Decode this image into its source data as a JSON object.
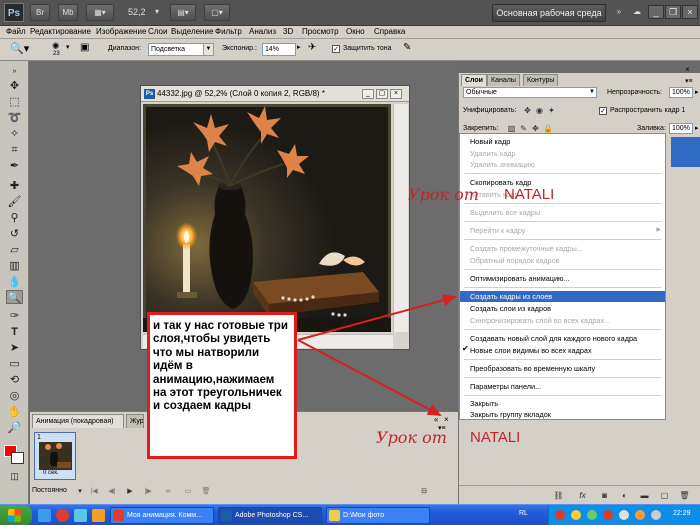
{
  "titlebar": {
    "app_logo": "Ps",
    "zoom": "52,2",
    "workspace": "Основная рабочая среда",
    "icons": [
      "bridge-icon",
      "minibridge-icon",
      "view-extras-icon",
      "zoom-dropdown-icon",
      "arrange-documents-icon",
      "screen-mode-icon"
    ]
  },
  "menu": [
    "Файл",
    "Редактирование",
    "Изображение",
    "Слои",
    "Выделение",
    "Фильтр",
    "Анализ",
    "3D",
    "Просмотр",
    "Окно",
    "Справка"
  ],
  "options": {
    "brush_size": "23",
    "range_label": "Диапазон:",
    "range_value": "Подсветка",
    "exposure_label": "Экспонир.:",
    "exposure_value": "14%",
    "protect_label": "Защитить тона"
  },
  "document": {
    "title": "44332.jpg @ 52,2% (Слой 0 копия 2, RGB/8) *"
  },
  "callout": {
    "text": "и так у нас  готовые три слоя,чтобы увидеть что мы натворили идём в анимацию,нажимаем на этот треугольничек и создаем кадры"
  },
  "watermarks": [
    {
      "script": "Урок  от",
      "name": "NATALI"
    },
    {
      "script": "Урок  от",
      "name": "NATALI"
    }
  ],
  "animation": {
    "tab_active": "Анимация (покадровая)",
    "tab_other": "Жур",
    "frame_number": "1",
    "frame_delay": "0 сек.",
    "loop": "Постоянно"
  },
  "layers_panel": {
    "tabs": [
      "Слои",
      "Каналы",
      "Контуры"
    ],
    "blend_mode": "Обычные",
    "opacity_label": "Непрозрачность:",
    "opacity_value": "100%",
    "unify_label": "Унифицировать:",
    "propagate_label": "Распространить кадр 1",
    "lock_label": "Закрепить:",
    "fill_label": "Заливка:",
    "fill_value": "100%"
  },
  "context_menu": {
    "items": [
      {
        "label": "Новый кадр",
        "state": "enabled"
      },
      {
        "label": "Удалить кадр",
        "state": "disabled"
      },
      {
        "label": "Удалить анимацию",
        "state": "disabled"
      },
      {
        "label": "Скопировать кадр",
        "state": "enabled"
      },
      {
        "label": "Вставить кадр...",
        "state": "disabled"
      },
      {
        "label": "Выделить все кадры",
        "state": "disabled"
      },
      {
        "label": "Перейти к кадру",
        "state": "disabled"
      },
      {
        "label": "Создать промежуточные кадры...",
        "state": "disabled"
      },
      {
        "label": "Обратный порядок кадров",
        "state": "disabled"
      },
      {
        "label": "Оптимизировать анимацию...",
        "state": "enabled"
      },
      {
        "label": "Создать кадры из слоев",
        "state": "highlighted"
      },
      {
        "label": "Создать слои из кадров",
        "state": "enabled"
      },
      {
        "label": "Синхронизировать слой во всех кадрах...",
        "state": "disabled"
      },
      {
        "label": "Создавать новый слой для каждого нового кадра",
        "state": "enabled"
      },
      {
        "label": "Новые слои видимы во всех кадрах",
        "state": "checked"
      },
      {
        "label": "Преобразовать во временную шкалу",
        "state": "enabled"
      },
      {
        "label": "Параметры панели...",
        "state": "enabled"
      },
      {
        "label": "Закрыть",
        "state": "enabled"
      },
      {
        "label": "Закрыть группу вкладок",
        "state": "enabled"
      }
    ]
  },
  "taskbar": {
    "tasks": [
      {
        "label": "Моя анимация. Комм...",
        "icon_color": "#e03a2a"
      },
      {
        "label": "Adobe Photoshop CS...",
        "icon_color": "#1b5ea8"
      },
      {
        "label": "D:\\Мои фото",
        "icon_color": "#f2c94c"
      }
    ],
    "lang": "RL",
    "time": "22:29"
  }
}
